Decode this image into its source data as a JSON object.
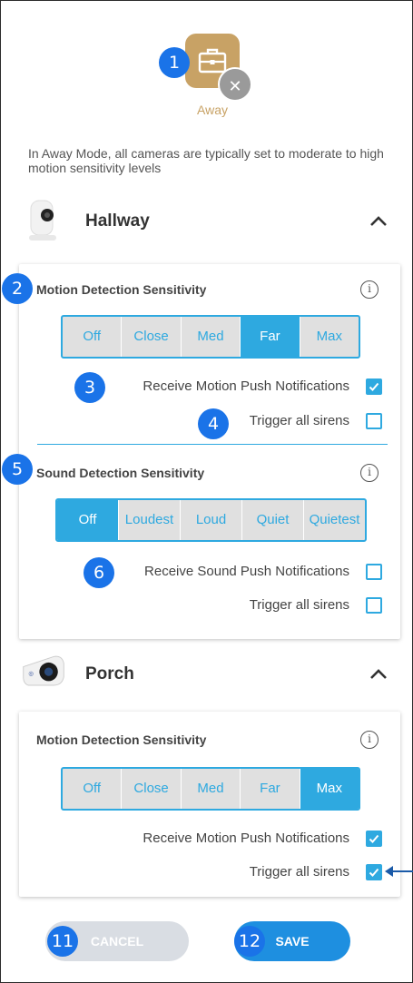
{
  "mode": {
    "label": "Away",
    "close_glyph": "✕"
  },
  "intro": "In Away Mode, all cameras are typically set to moderate to high motion sensitivity levels",
  "badges": [
    "1",
    "2",
    "3",
    "4",
    "5",
    "6",
    "11",
    "12"
  ],
  "hallway": {
    "name": "Hallway",
    "motion": {
      "title": "Motion Detection Sensitivity",
      "options": [
        "Off",
        "Close",
        "Med",
        "Far",
        "Max"
      ],
      "selected": "Far",
      "push_label": "Receive Motion Push Notifications",
      "push_checked": true,
      "sirens_label": "Trigger all sirens",
      "sirens_checked": false
    },
    "sound": {
      "title": "Sound Detection Sensitivity",
      "options": [
        "Off",
        "Loudest",
        "Loud",
        "Quiet",
        "Quietest"
      ],
      "selected": "Off",
      "push_label": "Receive Sound Push Notifications",
      "push_checked": false,
      "sirens_label": "Trigger all sirens",
      "sirens_checked": false
    }
  },
  "porch": {
    "name": "Porch",
    "motion": {
      "title": "Motion Detection Sensitivity",
      "options": [
        "Off",
        "Close",
        "Med",
        "Far",
        "Max"
      ],
      "selected": "Max",
      "push_label": "Receive Motion Push Notifications",
      "push_checked": true,
      "sirens_label": "Trigger all sirens",
      "sirens_checked": true
    }
  },
  "buttons": {
    "cancel": "CANCEL",
    "save": "SAVE"
  },
  "info_glyph": "i",
  "colors": {
    "accent": "#2ea9e0",
    "mode": "#c8a265",
    "badge": "#1a73e8",
    "save": "#1e8fe0"
  },
  "icons": [
    "briefcase-icon",
    "close-icon",
    "camera-indoor-icon",
    "camera-outdoor-icon",
    "chevron-up-icon",
    "info-icon",
    "check-icon",
    "arrow-left-icon"
  ]
}
